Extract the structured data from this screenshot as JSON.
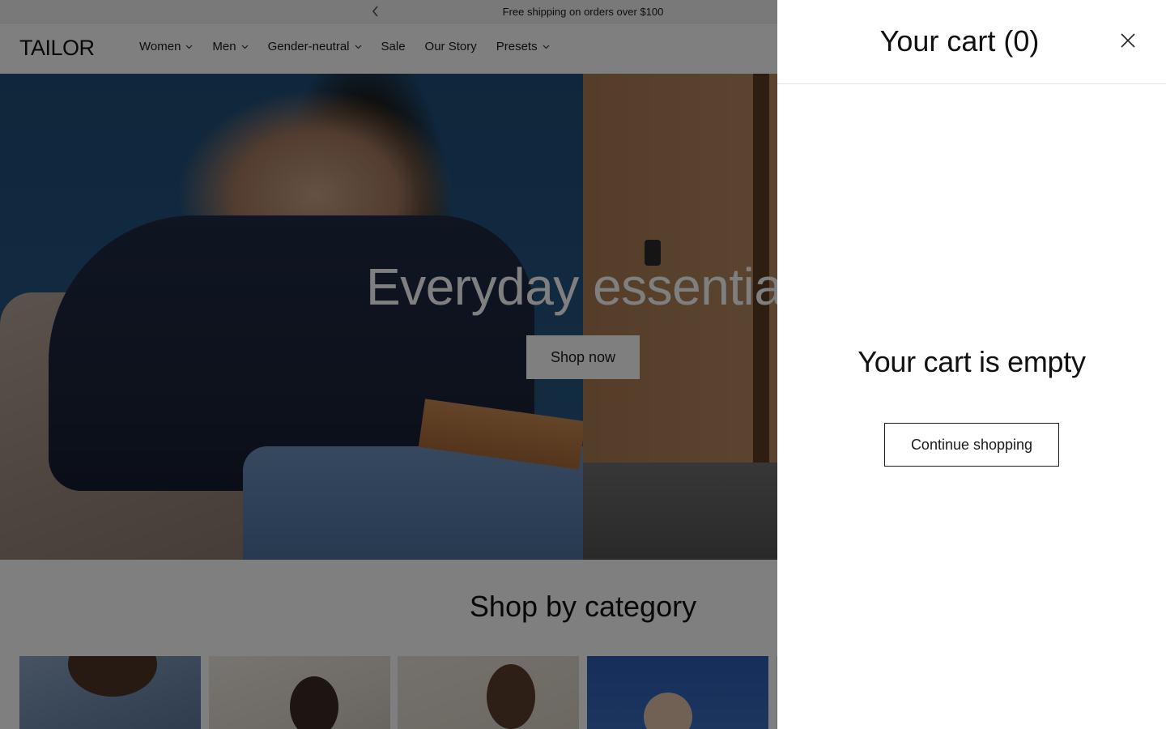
{
  "announcement": {
    "text": "Free shipping on orders over $100",
    "prev_icon": "chevron-left-icon"
  },
  "header": {
    "logo": "TAILOR",
    "nav": [
      {
        "label": "Women",
        "has_dropdown": true
      },
      {
        "label": "Men",
        "has_dropdown": true
      },
      {
        "label": "Gender-neutral",
        "has_dropdown": true
      },
      {
        "label": "Sale",
        "has_dropdown": false
      },
      {
        "label": "Our Story",
        "has_dropdown": false
      },
      {
        "label": "Presets",
        "has_dropdown": true
      }
    ]
  },
  "hero": {
    "title": "Everyday essentials",
    "cta_label": "Shop now"
  },
  "categories": {
    "title": "Shop by category"
  },
  "cart_drawer": {
    "title": "Your cart (0)",
    "close_icon": "close-icon",
    "empty_message": "Your cart is empty",
    "continue_label": "Continue shopping"
  },
  "colors": {
    "overlay": "rgba(0,0,0,0.5)",
    "text": "#1a1a1a",
    "drawer_bg": "#ffffff"
  }
}
